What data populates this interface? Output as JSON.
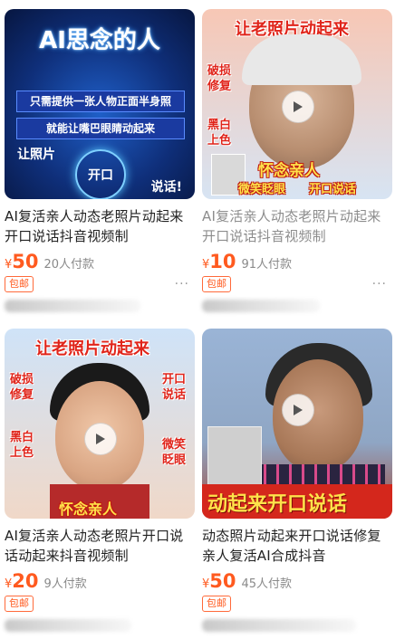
{
  "products": [
    {
      "thumb": {
        "headline": "AI思念的人",
        "line1": "只需提供一张人物正面半身照",
        "line2": "就能让嘴巴眼睛动起来",
        "left_text": "让照片",
        "center_text": "开口",
        "right_text": "说话!"
      },
      "title": "AI复活亲人动态老照片动起来开口说话抖音视频制",
      "currency": "¥",
      "price": "50",
      "sold": "20人付款",
      "tag": "包邮",
      "more": "···"
    },
    {
      "thumb": {
        "headline": "让老照片动起来",
        "side_top": "破损修复",
        "side_mid": "黑白上色",
        "banner1": "怀念亲人",
        "banner2a": "微笑眨眼",
        "banner2b": "开口说话"
      },
      "title": "AI复活亲人动态老照片动起来开口说话抖音视频制",
      "currency": "¥",
      "price": "10",
      "sold": "91人付款",
      "tag": "包邮",
      "more": "···"
    },
    {
      "thumb": {
        "headline": "让老照片动起来",
        "side_left_top": "破损修复",
        "side_left_mid": "黑白上色",
        "side_right_top": "开口说话",
        "side_right_mid": "微笑眨眼",
        "banner": "怀念亲人"
      },
      "title": "AI复活亲人动态老照片开口说话动起来抖音视频制",
      "currency": "¥",
      "price": "20",
      "sold": "9人付款",
      "tag": "包邮",
      "more": ""
    },
    {
      "thumb": {
        "banner": "动起来开口说话"
      },
      "title": "动态照片动起来开口说话修复亲人复活AI合成抖音",
      "currency": "¥",
      "price": "50",
      "sold": "45人付款",
      "tag": "包邮",
      "more": ""
    }
  ]
}
